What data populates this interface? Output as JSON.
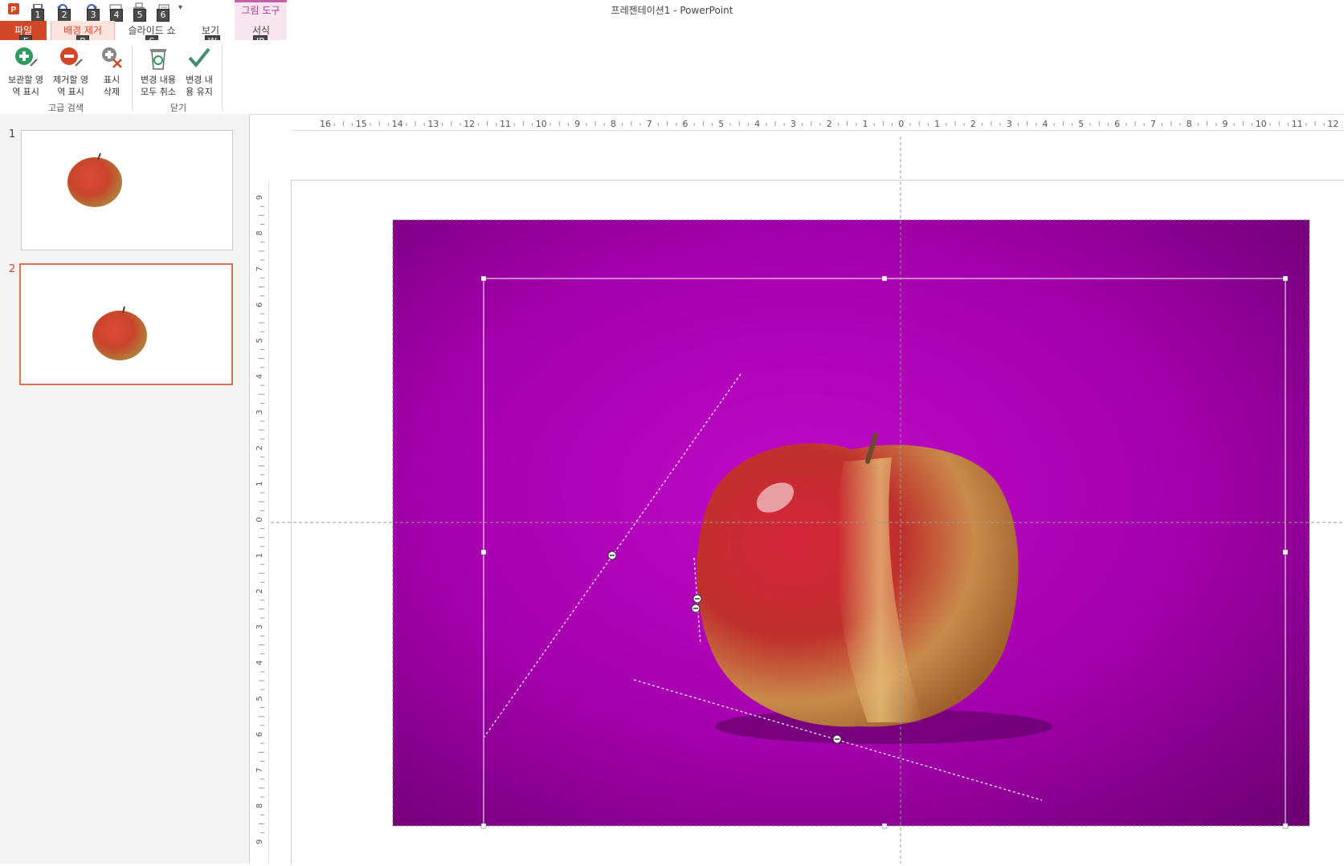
{
  "window": {
    "title": "프레젠테이션1 - PowerPoint"
  },
  "qat": {
    "keytips": [
      "1",
      "2",
      "3",
      "4",
      "5",
      "6"
    ]
  },
  "tabs": {
    "file": {
      "label": "파일",
      "keytip": "F"
    },
    "background_removal": {
      "label": "배경 제거",
      "keytip": "B"
    },
    "slideshow": {
      "label": "슬라이드 쇼",
      "keytip": "S"
    },
    "view": {
      "label": "보기",
      "keytip": "W"
    },
    "format": {
      "label": "서식",
      "keytip": "JP"
    },
    "context_group": "그림 도구"
  },
  "ribbon": {
    "refine_group": {
      "label": "고급 검색",
      "mark_keep": "보관할 영\n역 표시",
      "mark_remove": "제거할 영\n역 표시",
      "delete_mark": "표시\n삭제"
    },
    "close_group": {
      "label": "닫기",
      "discard": "변경 내용\n모두 취소",
      "keep": "변경 내\n용 유지"
    }
  },
  "slides": [
    {
      "number": "1"
    },
    {
      "number": "2",
      "selected": true
    }
  ],
  "ruler": {
    "horizontal": [
      "16",
      "15",
      "14",
      "13",
      "12",
      "11",
      "10",
      "9",
      "8",
      "7",
      "6",
      "5",
      "4",
      "3",
      "2",
      "1",
      "0",
      "1",
      "2",
      "3",
      "4",
      "5",
      "6",
      "7",
      "8",
      "9",
      "10",
      "11",
      "12"
    ],
    "vertical": [
      "9",
      "8",
      "7",
      "6",
      "5",
      "4",
      "3",
      "2",
      "1",
      "0",
      "1",
      "2",
      "3",
      "4",
      "5",
      "6",
      "7",
      "8",
      "9"
    ]
  },
  "colors": {
    "accent": "#d24726",
    "background_removal_magenta": "#b000b8",
    "tab_bg": "#fbe4de",
    "context_tab": "#c261a3"
  },
  "icons": [
    "powerpoint-logo-icon",
    "save-icon",
    "undo-icon",
    "redo-icon",
    "start-slideshow-icon",
    "print-icon",
    "customize-qat-icon",
    "mark-keep-icon",
    "mark-remove-icon",
    "delete-mark-icon",
    "discard-changes-icon",
    "keep-changes-icon"
  ]
}
